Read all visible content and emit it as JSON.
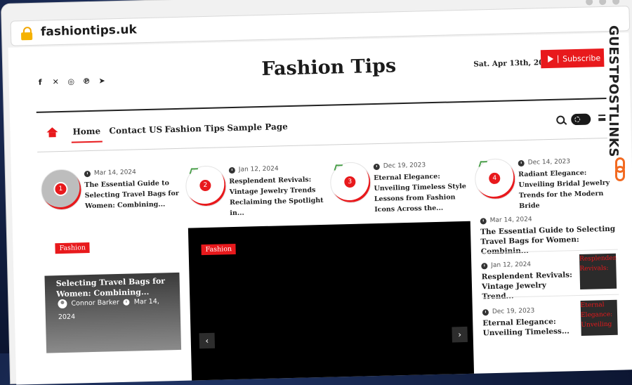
{
  "browser": {
    "url": "fashiontips.uk"
  },
  "header": {
    "site_title": "Fashion Tips",
    "date": "Sat. Apr 13th, 2024",
    "subscribe_label": "Subscribe",
    "social_icons": [
      "facebook-icon",
      "x-icon",
      "instagram-icon",
      "pinterest-icon",
      "telegram-icon"
    ]
  },
  "nav": {
    "items": [
      "Home",
      "Contact US",
      "Fashion Tips",
      "Sample Page"
    ],
    "active": "Home"
  },
  "trending": [
    {
      "num": "1",
      "date": "Mar 14, 2024",
      "title": "The Essential Guide to Selecting Travel Bags for Women: Combining..."
    },
    {
      "num": "2",
      "date": "Jan 12, 2024",
      "title": "Resplendent Revivals: Vintage Jewelry Trends Reclaiming the Spotlight in..."
    },
    {
      "num": "3",
      "date": "Dec 19, 2023",
      "title": "Eternal Elegance: Unveiling Timeless Style Lessons from Fashion Icons Across the..."
    },
    {
      "num": "4",
      "date": "Dec 14, 2023",
      "title": "Radiant Elegance: Unveiling Bridal Jewelry Trends for the Modern Bride"
    }
  ],
  "left_card": {
    "tag": "Fashion",
    "title": "Selecting Travel Bags for Women: Combining...",
    "author": "Connor Barker",
    "date": "Mar 14,",
    "year": "2024"
  },
  "slider": {
    "tag": "Fashion",
    "prev": "‹",
    "next": "›"
  },
  "right_list": [
    {
      "date": "Mar 14, 2024",
      "title": "The Essential Guide to Selecting Travel Bags for Women: Combinin..."
    },
    {
      "date": "Jan 12, 2024",
      "title": "Resplendent Revivals: Vintage Jewelry Trend...",
      "thumb_alt": "Resplendent Revivals:"
    },
    {
      "date": "Dec 19, 2023",
      "title": "Eternal Elegance: Unveiling Timeless...",
      "thumb_alt": "Eternal Elegance: Unveiling"
    }
  ],
  "watermark": "GUESTPOSTLINKS",
  "colors": {
    "accent": "#e8191c",
    "watermark_logo": "#f26a21"
  }
}
